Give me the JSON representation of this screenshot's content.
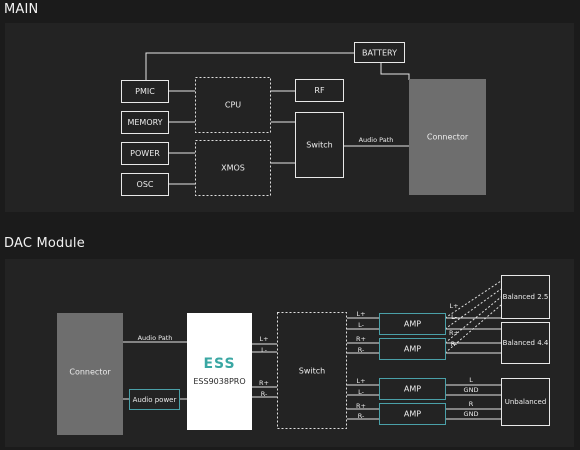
{
  "sections": {
    "main_title": "MAIN",
    "dac_title": "DAC Module"
  },
  "main": {
    "battery": "BATTERY",
    "pmic": "PMIC",
    "memory": "MEMORY",
    "power": "POWER",
    "osc": "OSC",
    "cpu": "CPU",
    "xmos": "XMOS",
    "rf": "RF",
    "switch": "Switch",
    "audio_path": "Audio Path",
    "connector": "Connector"
  },
  "dac": {
    "connector": "Connector",
    "audio_path": "Audio Path",
    "audio_power": "Audio power",
    "ess_logo": "ESS",
    "ess_chip": "ESS9038PRO",
    "switch": "Switch",
    "amp": "AMP",
    "chip_out_top": [
      "L+",
      "L-"
    ],
    "chip_out_bottom": [
      "R+",
      "R-"
    ],
    "switch_out": [
      "L+",
      "L-",
      "R+",
      "R-",
      "L+",
      "L-",
      "R+",
      "R-"
    ],
    "amp_out_balanced": [
      "L+",
      "L-",
      "R+",
      "R-"
    ],
    "amp_out_unbalanced": [
      "L",
      "GND",
      "R",
      "GND"
    ],
    "balanced_25": "Balanced 2.5",
    "balanced_44": "Balanced 4.4",
    "unbalanced": "Unbalanced"
  },
  "colors": {
    "background": "#1b1b1b",
    "panel": "#232323",
    "connector_fill": "#6e6e6e",
    "accent_teal": "#4aa0a8"
  }
}
